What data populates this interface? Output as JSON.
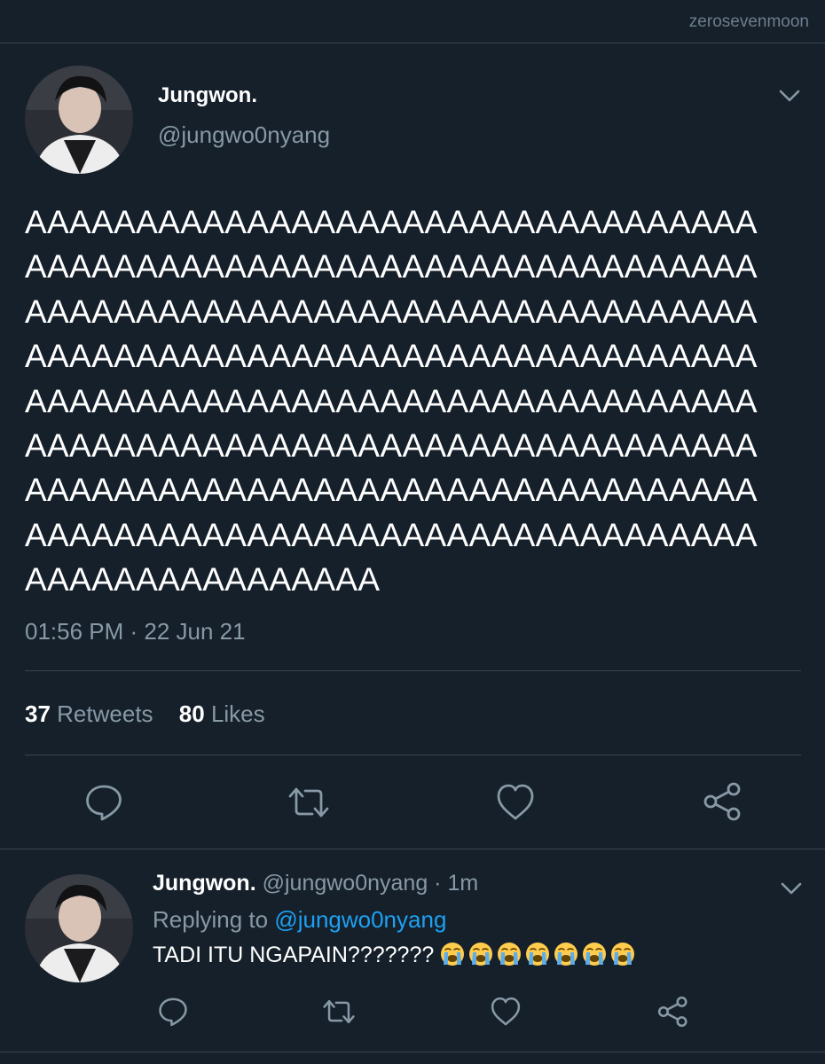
{
  "watermark": "zerosevenmoon",
  "main_tweet": {
    "name": "Jungwon.",
    "handle": "@jungwo0nyang",
    "text_lines": [
      "AAAAAAAAAAAAAAAAAAAAAAAAAAAAAAAAA",
      "AAAAAAAAAAAAAAAAAAAAAAAAAAAAAAAAA",
      "AAAAAAAAAAAAAAAAAAAAAAAAAAAAAAAAA",
      "AAAAAAAAAAAAAAAAAAAAAAAAAAAAAAAAA",
      "AAAAAAAAAAAAAAAAAAAAAAAAAAAAAAAAA",
      "AAAAAAAAAAAAAAAAAAAAAAAAAAAAAAAAA",
      "AAAAAAAAAAAAAAAAAAAAAAAAAAAAAAAAA",
      "AAAAAAAAAAAAAAAAAAAAAAAAAAAAAAAAA",
      "AAAAAAAAAAAAAAAA"
    ],
    "timestamp": "01:56 PM · 22 Jun 21",
    "retweets_count": "37",
    "retweets_label": "Retweets",
    "likes_count": "80",
    "likes_label": "Likes"
  },
  "reply_tweet": {
    "name": "Jungwon.",
    "handle_time": "@jungwo0nyang · 1m",
    "replying_prefix": "Replying to",
    "replying_handle": "@jungwo0nyang",
    "text": "TADI ITU NGAPAIN???????",
    "emoji_count": 7
  },
  "icons": {
    "reply": "comment-icon",
    "retweet": "retweet-icon",
    "like": "heart-icon",
    "share": "share-icon",
    "menu": "chevron-down-icon",
    "emoji": "loudly-crying-face-emoji"
  },
  "colors": {
    "background": "#15202b",
    "divider": "#38444d",
    "secondary_text": "#8899a6",
    "link": "#1da1f2"
  }
}
